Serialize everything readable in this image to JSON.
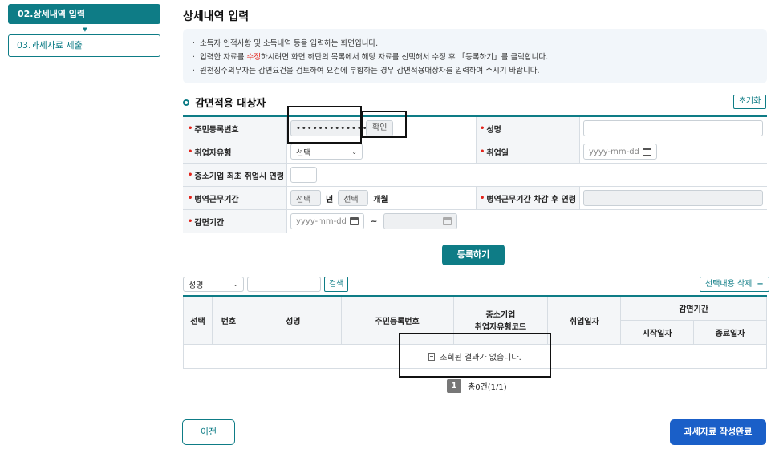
{
  "sidebar": {
    "active_item": "02.상세내역 입력",
    "items": [
      {
        "label": "03.과세자료 제출"
      }
    ]
  },
  "page": {
    "title": "상세내역 입력",
    "info": {
      "line1": "소득자 인적사항 및 소득내역 등을 입력하는 화면입니다.",
      "line2_a": "입력한 자료를 ",
      "line2_hl": "수정",
      "line2_b": "하시려면 화면 하단의 목록에서 해당 자료를 선택해서 수정 후 「등록하기」를 클릭합니다.",
      "line3": "원천징수의무자는 감면요건을 검토하여 요건에 부합하는 경우 감면적용대상자를 입력하여 주시기 바랍니다."
    }
  },
  "section": {
    "title": "감면적용 대상자",
    "reset_label": "초기화"
  },
  "form": {
    "req_mark": "•",
    "resident_no_label": "주민등록번호",
    "resident_no_value": "••••••••••••••",
    "confirm_label": "확인",
    "name_label": "성명",
    "name_value": "",
    "employ_type_label": "취업자유형",
    "employ_type_value": "선택",
    "employ_date_label": "취업일",
    "date_placeholder": "yyyy-mm-dd",
    "age_label": "중소기업 최초 취업시 연령",
    "military_label": "병역근무기간",
    "military_year_value": "선택",
    "year_unit": "년",
    "military_month_value": "선택",
    "month_unit": "개월",
    "after_military_age_label": "병역근무기간 차감 후 연령",
    "reduction_period_label": "감면기간",
    "tilde": "~"
  },
  "register_label": "등록하기",
  "search": {
    "field_value": "성명",
    "button_label": "검색",
    "delete_label": "선택내용 삭제",
    "delete_icon": "−"
  },
  "table": {
    "headers": {
      "select": "선택",
      "number": "번호",
      "name": "성명",
      "resident_no": "주민등록번호",
      "sme_line1": "중소기업",
      "sme_line2": "취업자유형코드",
      "employ_date": "취업일자",
      "period": "감면기간",
      "start": "시작일자",
      "end": "종료일자"
    },
    "empty_message": "조회된 결과가 없습니다."
  },
  "pager": {
    "current": "1",
    "total": "총0건(1/1)"
  },
  "footer": {
    "prev_label": "이전",
    "complete_label": "과세자료 작성완료"
  },
  "colors": {
    "accent": "#0e7c86",
    "primary": "#1a5fc8",
    "required": "#e2231a"
  }
}
